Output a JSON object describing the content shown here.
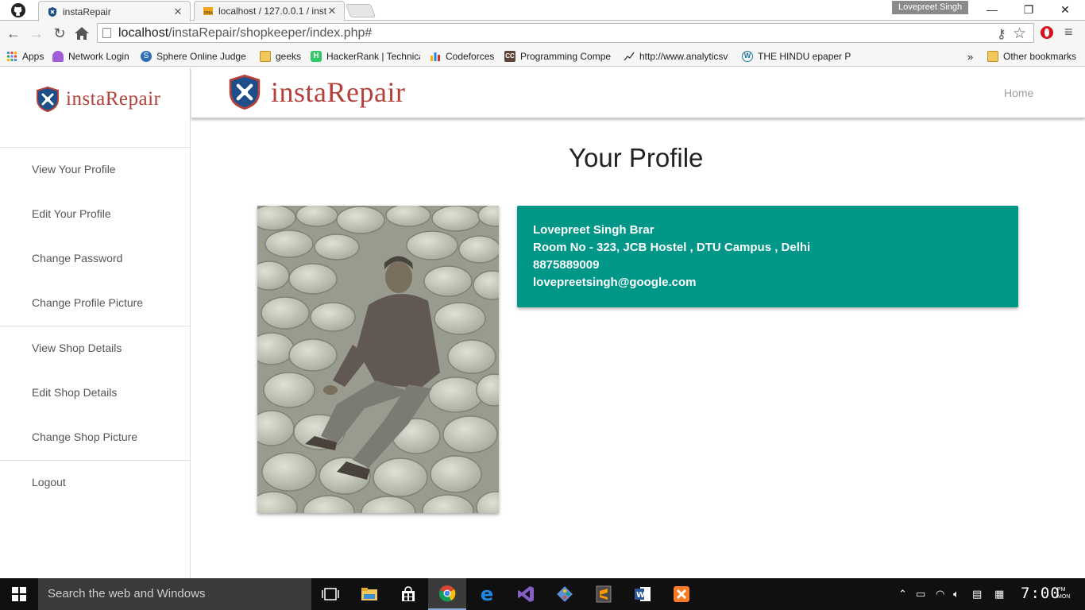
{
  "browser": {
    "tabs": [
      {
        "title": "instaRepair"
      },
      {
        "title": "localhost / 127.0.0.1 / inst"
      }
    ],
    "profile_name": "Lovepreet Singh",
    "url_host": "localhost",
    "url_path": "/instaRepair/shopkeeper/index.php#",
    "bookmarks": [
      "Apps",
      "Network Login",
      "Sphere Online Judge",
      "geeks",
      "HackerRank | Technica",
      "Codeforces",
      "Programming Compe",
      "http://www.analyticsv",
      "THE HINDU epaper PE"
    ],
    "overflow": "»",
    "other_bookmarks": "Other bookmarks"
  },
  "app": {
    "brand": "instaRepair",
    "colors": {
      "brand": "#b5403a",
      "card": "#009688"
    },
    "nav": {
      "home": "Home"
    },
    "sidebar": {
      "items": [
        "View Your Profile",
        "Edit Your Profile",
        "Change Password",
        "Change Profile Picture",
        "View Shop Details",
        "Edit Shop Details",
        "Change Shop Picture",
        "Logout"
      ]
    },
    "page_title": "Your Profile",
    "profile": {
      "name": "Lovepreet Singh Brar",
      "address": "Room No - 323, JCB Hostel , DTU Campus , Delhi",
      "phone": "8875889009",
      "email": "lovepreetsingh@google.com"
    }
  },
  "taskbar": {
    "search_placeholder": "Search the web and Windows",
    "time": "7:00",
    "ampm": "PM",
    "day": "MON"
  }
}
